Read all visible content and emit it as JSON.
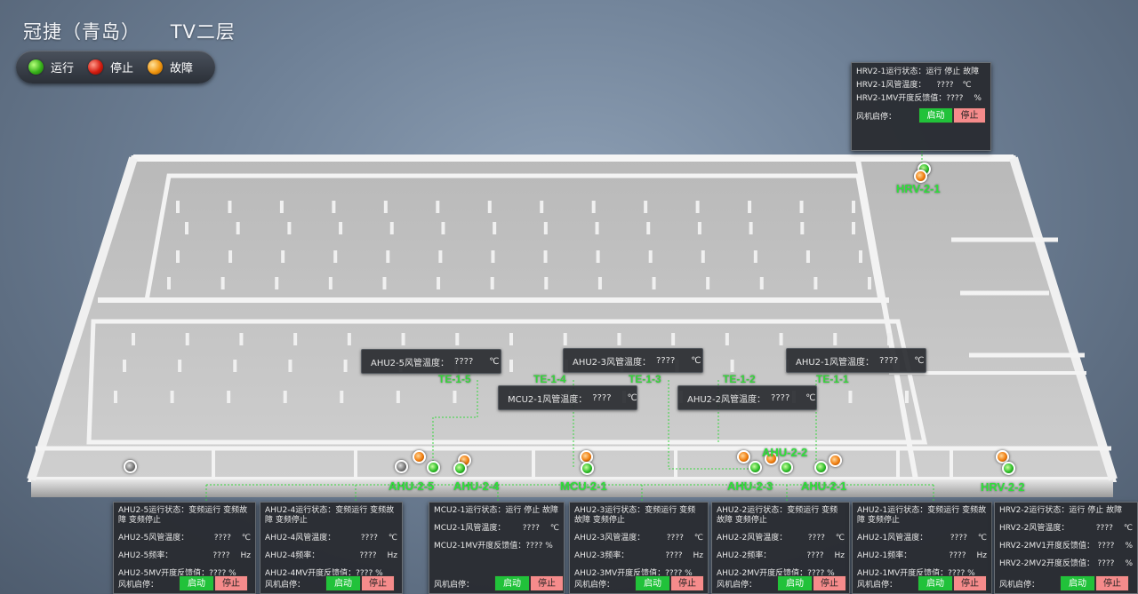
{
  "header": {
    "title": "冠捷（青岛）",
    "floor": "TV二层"
  },
  "legend": [
    {
      "label": "运行",
      "color": "#37b11a"
    },
    {
      "label": "停止",
      "color": "#d41c10"
    },
    {
      "label": "故障",
      "color": "#f0950e"
    }
  ],
  "sensors": [
    {
      "label": "AHU2-5风管温度：",
      "value": "????",
      "unit": "℃"
    },
    {
      "label": "AHU2-3风管温度：",
      "value": "????",
      "unit": "℃"
    },
    {
      "label": "AHU2-1风管温度：",
      "value": "????",
      "unit": "℃"
    },
    {
      "label": "MCU2-1风管温度：",
      "value": "????",
      "unit": "℃"
    },
    {
      "label": "AHU2-2风管温度：",
      "value": "????",
      "unit": "℃"
    }
  ],
  "te_labels": [
    "TE-1-5",
    "TE-1-4",
    "TE-1-3",
    "TE-1-2",
    "TE-1-1"
  ],
  "equipment_labels": [
    "AHU-2-5",
    "AHU-2-4",
    "MCU-2-1",
    "AHU-2-3",
    "AHU-2-2",
    "AHU-2-1",
    "HRV-2-2",
    "HRV-2-1"
  ],
  "hrv_top": {
    "status": "HRV2-1运行状态：运行 停止 故障",
    "temp_label": "HRV2-1风管温度：",
    "temp_value": "????",
    "temp_unit": "℃",
    "mv_label": "HRV2-1MV开度反馈值：????",
    "mv_unit": "%",
    "fan_label": "风机启停：",
    "start": "启动",
    "stop": "停止"
  },
  "panels": [
    {
      "status": "AHU2-5运行状态：变频运行 变频故障 变频停止",
      "rows": [
        [
          "AHU2-5风管温度：",
          "????",
          "℃"
        ],
        [
          "AHU2-5频率：",
          "????",
          "Hz"
        ],
        [
          "AHU2-5MV开度反馈值：???? %",
          "",
          ""
        ]
      ],
      "fan_label": "风机启停：",
      "start": "启动",
      "stop": "停止"
    },
    {
      "status": "AHU2-4运行状态：变频运行 变频故障 变频停止",
      "rows": [
        [
          "AHU2-4风管温度：",
          "????",
          "℃"
        ],
        [
          "AHU2-4频率：",
          "????",
          "Hz"
        ],
        [
          "AHU2-4MV开度反馈值：???? %",
          "",
          ""
        ]
      ],
      "fan_label": "风机启停：",
      "start": "启动",
      "stop": "停止"
    },
    {
      "status": "MCU2-1运行状态：运行 停止 故障",
      "rows": [
        [
          "MCU2-1风管温度：",
          "????",
          "℃"
        ],
        [
          "MCU2-1MV开度反馈值：???? %",
          "",
          ""
        ]
      ],
      "fan_label": "风机启停：",
      "start": "启动",
      "stop": "停止"
    },
    {
      "status": "AHU2-3运行状态：变频运行 变频故障 变频停止",
      "rows": [
        [
          "AHU2-3风管温度：",
          "????",
          "℃"
        ],
        [
          "AHU2-3频率：",
          "????",
          "Hz"
        ],
        [
          "AHU2-3MV开度反馈值：???? %",
          "",
          ""
        ]
      ],
      "fan_label": "风机启停：",
      "start": "启动",
      "stop": "停止"
    },
    {
      "status": "AHU2-2运行状态：变频运行 变频故障 变频停止",
      "rows": [
        [
          "AHU2-2风管温度：",
          "????",
          "℃"
        ],
        [
          "AHU2-2频率：",
          "????",
          "Hz"
        ],
        [
          "AHU2-2MV开度反馈值：???? %",
          "",
          ""
        ]
      ],
      "fan_label": "风机启停：",
      "start": "启动",
      "stop": "停止"
    },
    {
      "status": "AHU2-1运行状态：变频运行 变频故障 变频停止",
      "rows": [
        [
          "AHU2-1风管温度：",
          "????",
          "℃"
        ],
        [
          "AHU2-1频率：",
          "????",
          "Hz"
        ],
        [
          "AHU2-1MV开度反馈值：???? %",
          "",
          ""
        ]
      ],
      "fan_label": "风机启停：",
      "start": "启动",
      "stop": "停止"
    },
    {
      "status": "HRV2-2运行状态：运行 停止 故障",
      "rows": [
        [
          "HRV2-2风管温度：",
          "????",
          "℃"
        ],
        [
          "HRV2-2MV1开度反馈值：",
          "????",
          "%"
        ],
        [
          "HRV2-2MV2开度反馈值：",
          "????",
          "%"
        ]
      ],
      "fan_label": "风机启停：",
      "start": "启动",
      "stop": "停止"
    }
  ]
}
